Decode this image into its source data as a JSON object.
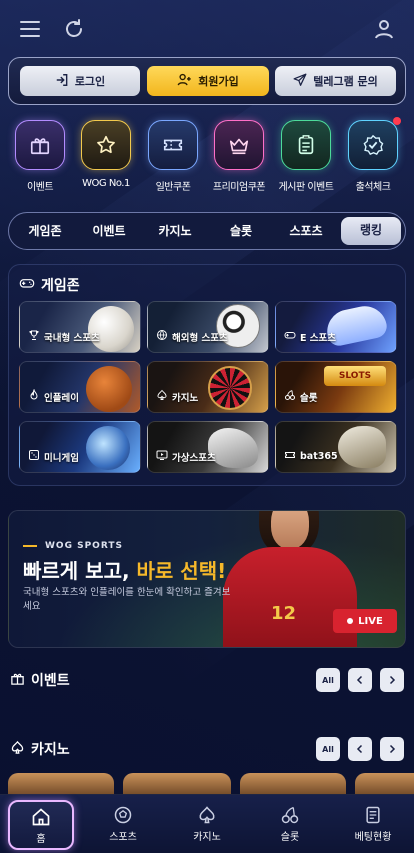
{
  "auth": {
    "login": "로그인",
    "signup": "회원가입",
    "telegram": "텔레그램 문의"
  },
  "quick": [
    {
      "label": "이벤트",
      "icon": "gift-icon",
      "color": "#b38cff"
    },
    {
      "label": "WOG No.1",
      "icon": "star-icon",
      "color": "#f2c94c"
    },
    {
      "label": "일반쿠폰",
      "icon": "ticket-icon",
      "color": "#7aa7ff"
    },
    {
      "label": "프리미엄쿠폰",
      "icon": "crown-icon",
      "color": "#ff6fc8"
    },
    {
      "label": "게시판 이벤트",
      "icon": "clipboard-icon",
      "color": "#4cdb9a"
    },
    {
      "label": "출석체크",
      "icon": "check-badge-icon",
      "color": "#5fd3ff"
    }
  ],
  "tabs": [
    "게임존",
    "이벤트",
    "카지노",
    "슬롯",
    "스포츠",
    "랭킹"
  ],
  "active_tab": "랭킹",
  "gamezone": {
    "title": "게임존",
    "tiles": [
      {
        "label": "국내형 스포츠",
        "icon": "trophy-icon"
      },
      {
        "label": "해외형 스포츠",
        "icon": "globe-icon"
      },
      {
        "label": "E 스포츠",
        "icon": "gamepad-icon"
      },
      {
        "label": "인플레이",
        "icon": "flame-icon"
      },
      {
        "label": "카지노",
        "icon": "spade-icon"
      },
      {
        "label": "슬롯",
        "icon": "cherry-icon"
      },
      {
        "label": "미니게임",
        "icon": "dice-icon"
      },
      {
        "label": "가상스포츠",
        "icon": "screen-play-icon"
      },
      {
        "label": "bat365",
        "icon": "ticket-icon"
      }
    ]
  },
  "banner": {
    "brand": "WOG SPORTS",
    "title_white": "빠르게 보고,",
    "title_gold": "바로 선택!",
    "desc": "국내형 스포츠와 인플레이를 한눈에 확인하고 즐겨보세요",
    "live": "LIVE",
    "jersey_number": "12"
  },
  "sections": {
    "event": {
      "title": "이벤트",
      "all": "All"
    },
    "casino": {
      "title": "카지노",
      "all": "All"
    }
  },
  "bottom_nav": [
    {
      "label": "홈",
      "icon": "home-icon"
    },
    {
      "label": "스포츠",
      "icon": "soccer-ball-icon"
    },
    {
      "label": "카지노",
      "icon": "spade-icon"
    },
    {
      "label": "슬롯",
      "icon": "cherry-icon"
    },
    {
      "label": "베팅현황",
      "icon": "document-icon"
    }
  ],
  "colors": {
    "accent_gold": "#f5b82a",
    "live_red": "#d8232f",
    "bg": "#0c1433"
  }
}
